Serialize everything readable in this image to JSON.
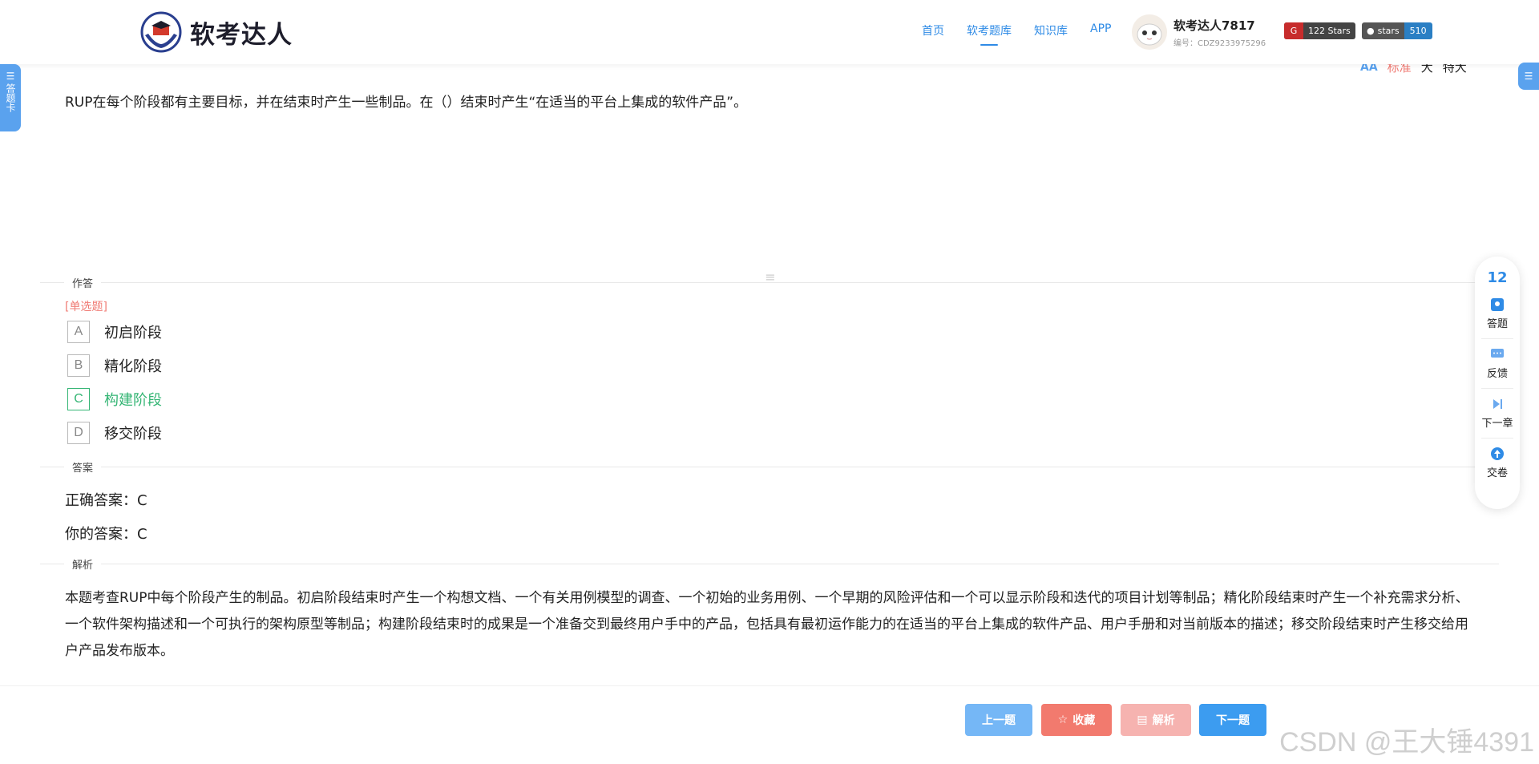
{
  "header": {
    "logo_text": "软考达人",
    "nav": [
      {
        "label": "首页",
        "active": false
      },
      {
        "label": "软考题库",
        "active": true
      },
      {
        "label": "知识库",
        "active": false
      },
      {
        "label": "APP",
        "active": false
      }
    ],
    "user": {
      "name": "软考达人7817",
      "id": "编号：CDZ9233975296"
    },
    "gitee_badge": "122 Stars",
    "github_badge": {
      "label": "stars",
      "count": "510"
    }
  },
  "left_tab": {
    "label": "答题卡"
  },
  "font_size": {
    "options": [
      "标准",
      "大",
      "特大"
    ],
    "selected": "标准"
  },
  "question": {
    "text": "RUP在每个阶段都有主要目标，并在结束时产生一些制品。在（）结束时产生“在适当的平台上集成的软件产品”。",
    "type": "[单选题]",
    "options": [
      {
        "key": "A",
        "text": "初启阶段",
        "correct": false
      },
      {
        "key": "B",
        "text": "精化阶段",
        "correct": false
      },
      {
        "key": "C",
        "text": "构建阶段",
        "correct": true
      },
      {
        "key": "D",
        "text": "移交阶段",
        "correct": false
      }
    ]
  },
  "sections": {
    "answer_input": "作答",
    "answer": "答案",
    "analysis": "解析"
  },
  "answer": {
    "correct": "正确答案：C",
    "yours": "你的答案：C"
  },
  "analysis_text": "本题考查RUP中每个阶段产生的制品。初启阶段结束时产生一个构想文档、一个有关用例模型的调查、一个初始的业务用例、一个早期的风险评估和一个可以显示阶段和迭代的项目计划等制品；精化阶段结束时产生一个补充需求分析、一个软件架构描述和一个可执行的架构原型等制品；构建阶段结束时的成果是一个准备交到最终用户手中的产品，包括具有最初运作能力的在适当的平台上集成的软件产品、用户手册和对当前版本的描述；移交阶段结束时产生移交给用户产品发布版本。",
  "float_panel": {
    "number": "12",
    "items": [
      "答题",
      "反馈",
      "下一章",
      "交卷"
    ]
  },
  "buttons": {
    "prev": "上一题",
    "fav": "收藏",
    "analysis": "解析",
    "next": "下一题"
  },
  "watermark": "CSDN @王大锤4391"
}
